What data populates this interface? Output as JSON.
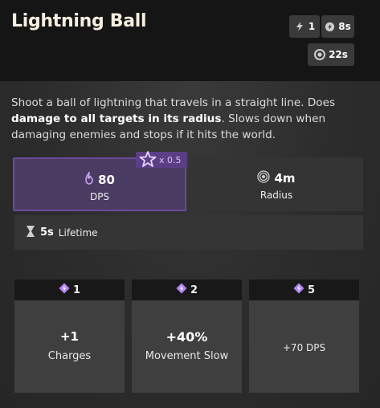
{
  "ability": {
    "title": "Lightning Ball",
    "charges_value": "1",
    "cooldown_value": "8s",
    "recharge_value": "22s"
  },
  "description": {
    "part1": "Shoot a ball of lightning that travels in a straight line. Does ",
    "bold": "damage to all targets in its radius",
    "part2": ". Slows down when damaging enemies and stops if it hits the world."
  },
  "stats": {
    "dps": {
      "value": "80",
      "label": "DPS",
      "multiplier": "x 0.5"
    },
    "radius": {
      "value": "4m",
      "label": "Radius"
    },
    "lifetime": {
      "value": "5s",
      "label": "Lifetime"
    }
  },
  "upgrades": [
    {
      "cost": "1",
      "value": "+1",
      "label": "Charges"
    },
    {
      "cost": "2",
      "value": "+40%",
      "label": "Movement Slow"
    },
    {
      "cost": "5",
      "value": "+70 DPS",
      "label": ""
    }
  ],
  "colors": {
    "accent_purple": "#6a4a9d",
    "header_bg": "#151515",
    "panel_bg": "#343434"
  },
  "icons": {
    "charges": "lightning-bolt-icon",
    "cooldown": "cooldown-icon",
    "recharge": "recharge-icon",
    "dps": "spirit-flame-icon",
    "radius": "radius-rings-icon",
    "lifetime": "hourglass-icon",
    "multiplier": "spirit-star-icon",
    "upgrade_cost": "ability-point-icon"
  }
}
